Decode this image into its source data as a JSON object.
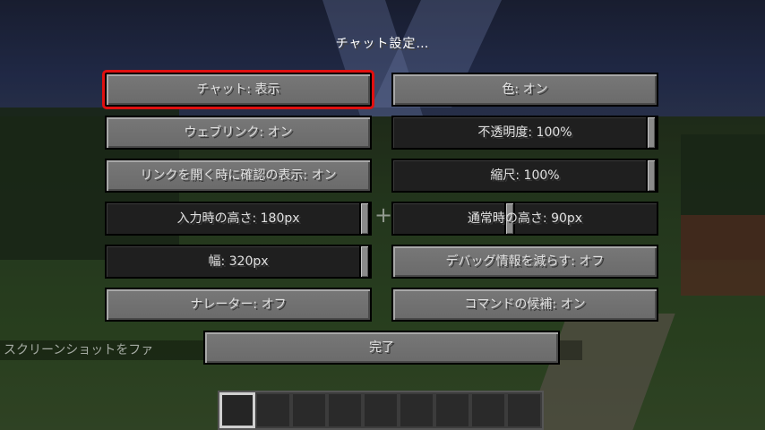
{
  "screen": {
    "title": "チャット設定…"
  },
  "buttons": {
    "chat": "チャット: 表示",
    "colors": "色: オン",
    "web_links": "ウェブリンク: オン",
    "prompt_links": "リンクを開く時に確認の表示: オン",
    "reduced_debug": "デバッグ情報を減らす: オフ",
    "narrator": "ナレーター: オフ",
    "command_suggestions": "コマンドの候補: オン",
    "done": "完了"
  },
  "sliders": {
    "opacity": {
      "label": "不透明度: 100%",
      "value": 1.0
    },
    "scale": {
      "label": "縮尺: 100%",
      "value": 1.0
    },
    "focused_height": {
      "label": "入力時の高さ: 180px",
      "value": 1.0
    },
    "unfocused_height": {
      "label": "通常時の高さ: 90px",
      "value": 0.44
    },
    "width": {
      "label": "幅: 320px",
      "value": 1.0
    }
  },
  "background": {
    "chat_message": "スクリーンショットをファ",
    "hotbar_slots": 9,
    "selected_slot": 1
  },
  "colors": {
    "highlight": "#e01010",
    "button_face": "#6f6f6f",
    "slider_track": "#1f1f1f",
    "text": "#e0e0e0"
  }
}
